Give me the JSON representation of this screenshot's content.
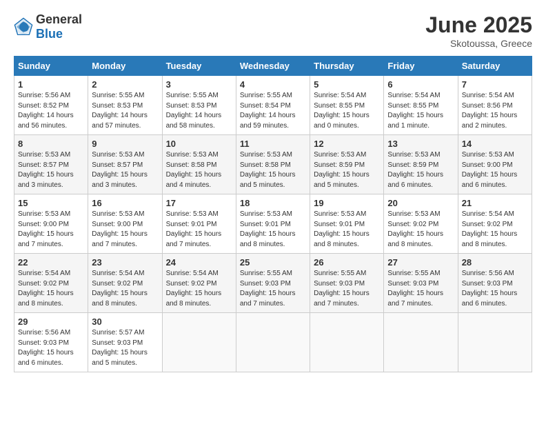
{
  "logo": {
    "general": "General",
    "blue": "Blue"
  },
  "title": "June 2025",
  "location": "Skotoussa, Greece",
  "days_header": [
    "Sunday",
    "Monday",
    "Tuesday",
    "Wednesday",
    "Thursday",
    "Friday",
    "Saturday"
  ],
  "weeks": [
    [
      {
        "day": "1",
        "info": "Sunrise: 5:56 AM\nSunset: 8:52 PM\nDaylight: 14 hours\nand 56 minutes."
      },
      {
        "day": "2",
        "info": "Sunrise: 5:55 AM\nSunset: 8:53 PM\nDaylight: 14 hours\nand 57 minutes."
      },
      {
        "day": "3",
        "info": "Sunrise: 5:55 AM\nSunset: 8:53 PM\nDaylight: 14 hours\nand 58 minutes."
      },
      {
        "day": "4",
        "info": "Sunrise: 5:55 AM\nSunset: 8:54 PM\nDaylight: 14 hours\nand 59 minutes."
      },
      {
        "day": "5",
        "info": "Sunrise: 5:54 AM\nSunset: 8:55 PM\nDaylight: 15 hours\nand 0 minutes."
      },
      {
        "day": "6",
        "info": "Sunrise: 5:54 AM\nSunset: 8:55 PM\nDaylight: 15 hours\nand 1 minute."
      },
      {
        "day": "7",
        "info": "Sunrise: 5:54 AM\nSunset: 8:56 PM\nDaylight: 15 hours\nand 2 minutes."
      }
    ],
    [
      {
        "day": "8",
        "info": "Sunrise: 5:53 AM\nSunset: 8:57 PM\nDaylight: 15 hours\nand 3 minutes."
      },
      {
        "day": "9",
        "info": "Sunrise: 5:53 AM\nSunset: 8:57 PM\nDaylight: 15 hours\nand 3 minutes."
      },
      {
        "day": "10",
        "info": "Sunrise: 5:53 AM\nSunset: 8:58 PM\nDaylight: 15 hours\nand 4 minutes."
      },
      {
        "day": "11",
        "info": "Sunrise: 5:53 AM\nSunset: 8:58 PM\nDaylight: 15 hours\nand 5 minutes."
      },
      {
        "day": "12",
        "info": "Sunrise: 5:53 AM\nSunset: 8:59 PM\nDaylight: 15 hours\nand 5 minutes."
      },
      {
        "day": "13",
        "info": "Sunrise: 5:53 AM\nSunset: 8:59 PM\nDaylight: 15 hours\nand 6 minutes."
      },
      {
        "day": "14",
        "info": "Sunrise: 5:53 AM\nSunset: 9:00 PM\nDaylight: 15 hours\nand 6 minutes."
      }
    ],
    [
      {
        "day": "15",
        "info": "Sunrise: 5:53 AM\nSunset: 9:00 PM\nDaylight: 15 hours\nand 7 minutes."
      },
      {
        "day": "16",
        "info": "Sunrise: 5:53 AM\nSunset: 9:00 PM\nDaylight: 15 hours\nand 7 minutes."
      },
      {
        "day": "17",
        "info": "Sunrise: 5:53 AM\nSunset: 9:01 PM\nDaylight: 15 hours\nand 7 minutes."
      },
      {
        "day": "18",
        "info": "Sunrise: 5:53 AM\nSunset: 9:01 PM\nDaylight: 15 hours\nand 8 minutes."
      },
      {
        "day": "19",
        "info": "Sunrise: 5:53 AM\nSunset: 9:01 PM\nDaylight: 15 hours\nand 8 minutes."
      },
      {
        "day": "20",
        "info": "Sunrise: 5:53 AM\nSunset: 9:02 PM\nDaylight: 15 hours\nand 8 minutes."
      },
      {
        "day": "21",
        "info": "Sunrise: 5:54 AM\nSunset: 9:02 PM\nDaylight: 15 hours\nand 8 minutes."
      }
    ],
    [
      {
        "day": "22",
        "info": "Sunrise: 5:54 AM\nSunset: 9:02 PM\nDaylight: 15 hours\nand 8 minutes."
      },
      {
        "day": "23",
        "info": "Sunrise: 5:54 AM\nSunset: 9:02 PM\nDaylight: 15 hours\nand 8 minutes."
      },
      {
        "day": "24",
        "info": "Sunrise: 5:54 AM\nSunset: 9:02 PM\nDaylight: 15 hours\nand 8 minutes."
      },
      {
        "day": "25",
        "info": "Sunrise: 5:55 AM\nSunset: 9:03 PM\nDaylight: 15 hours\nand 7 minutes."
      },
      {
        "day": "26",
        "info": "Sunrise: 5:55 AM\nSunset: 9:03 PM\nDaylight: 15 hours\nand 7 minutes."
      },
      {
        "day": "27",
        "info": "Sunrise: 5:55 AM\nSunset: 9:03 PM\nDaylight: 15 hours\nand 7 minutes."
      },
      {
        "day": "28",
        "info": "Sunrise: 5:56 AM\nSunset: 9:03 PM\nDaylight: 15 hours\nand 6 minutes."
      }
    ],
    [
      {
        "day": "29",
        "info": "Sunrise: 5:56 AM\nSunset: 9:03 PM\nDaylight: 15 hours\nand 6 minutes."
      },
      {
        "day": "30",
        "info": "Sunrise: 5:57 AM\nSunset: 9:03 PM\nDaylight: 15 hours\nand 5 minutes."
      },
      {
        "day": "",
        "info": ""
      },
      {
        "day": "",
        "info": ""
      },
      {
        "day": "",
        "info": ""
      },
      {
        "day": "",
        "info": ""
      },
      {
        "day": "",
        "info": ""
      }
    ]
  ]
}
